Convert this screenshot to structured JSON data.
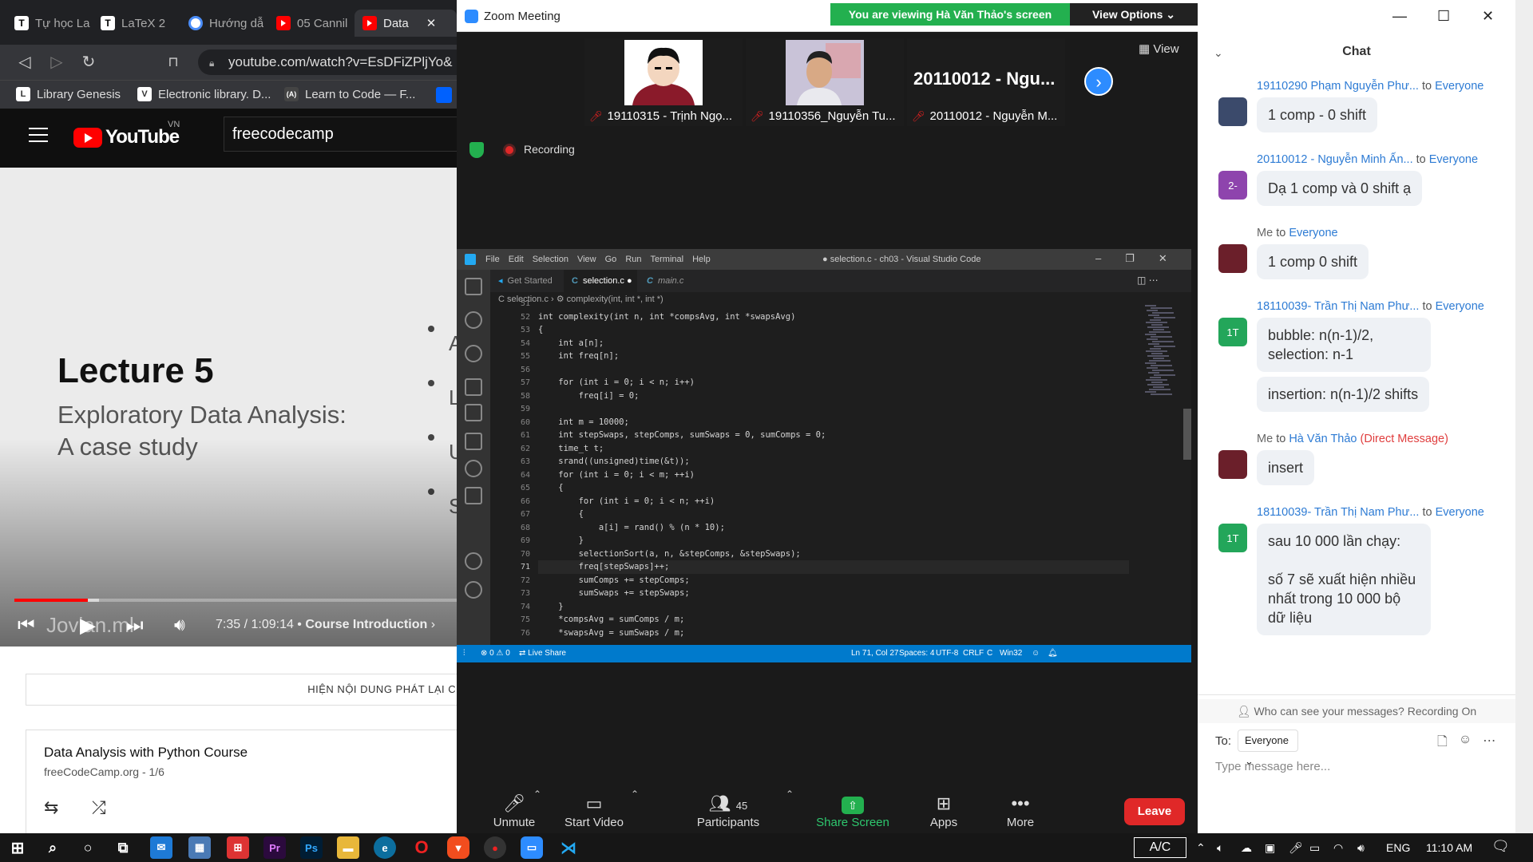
{
  "browser": {
    "tabs": [
      {
        "title": "Tự học La",
        "icon": "T"
      },
      {
        "title": "LaTeX 2",
        "icon": "T"
      },
      {
        "title": "Hướng dẫ",
        "icon": "circle"
      },
      {
        "title": "05 Cannil",
        "icon": "youtube"
      },
      {
        "title": "Data",
        "icon": "youtube",
        "active": true
      }
    ],
    "tab_close": "✕",
    "url": "youtube.com/watch?v=EsDFiZPljYo&",
    "bookmarks": [
      {
        "label": "Library Genesis",
        "icon": "L"
      },
      {
        "label": "Electronic library. D...",
        "icon": "V"
      },
      {
        "label": "Learn to Code — F...",
        "icon": "(A)"
      }
    ]
  },
  "youtube": {
    "logo_text": "YouTube",
    "country": "VN",
    "search_value": "freecodecamp",
    "slide": {
      "title": "Lecture 5",
      "subtitle_line1": "Exploratory Data Analysis:",
      "subtitle_line2": "A case study",
      "bullet_letters": [
        "A",
        "L",
        "U",
        "S"
      ]
    },
    "watermark": "Jovian.ml",
    "time": "7:35 / 1:09:14",
    "chapter": "Course Introduction",
    "chapter_arrow": "›",
    "progress_played": 0.165,
    "progress_buffered": 0.19,
    "replay_banner": "HIỆN NỘI DUNG PHÁT LẠI CU",
    "playlist_title": "Data Analysis with Python Course",
    "playlist_sub": "freeCodeCamp.org - 1/6"
  },
  "zoom": {
    "window_title": "Zoom Meeting",
    "banner": "You are viewing Hà Văn Thảo's screen",
    "view_options": "View Options ⌄",
    "view_label": "View",
    "recording": "Recording",
    "participants": [
      {
        "name": "19110315 - Trịnh Ngọ..."
      },
      {
        "name": "19110356_Nguyễn Tu..."
      },
      {
        "name": "20110012 - Nguyễn M...",
        "big_label": "20110012 - Ngu..."
      }
    ],
    "toolbar": {
      "unmute": "Unmute",
      "start_video": "Start Video",
      "participants": "Participants",
      "participants_count": "45",
      "share_screen": "Share Screen",
      "apps": "Apps",
      "more": "More",
      "leave": "Leave"
    }
  },
  "vscode": {
    "menu": [
      "File",
      "Edit",
      "Selection",
      "View",
      "Go",
      "Run",
      "Terminal",
      "Help"
    ],
    "window_title": "● selection.c - ch03 - Visual Studio Code",
    "tabs": [
      {
        "label": "Get Started",
        "prefix": ""
      },
      {
        "label": "selection.c",
        "prefix": "C",
        "modified": "●"
      },
      {
        "label": "main.c",
        "prefix": "C"
      }
    ],
    "breadcrumb": "C  selection.c  ›  ⚙ complexity(int, int *, int *)",
    "current_line": 71,
    "lines": [
      {
        "n": "51",
        "t": ""
      },
      {
        "n": "52",
        "t": "int complexity(int n, int *compsAvg, int *swapsAvg)"
      },
      {
        "n": "53",
        "t": "{"
      },
      {
        "n": "54",
        "t": "    int a[n];"
      },
      {
        "n": "55",
        "t": "    int freq[n];"
      },
      {
        "n": "56",
        "t": ""
      },
      {
        "n": "57",
        "t": "    for (int i = 0; i < n; i++)"
      },
      {
        "n": "58",
        "t": "        freq[i] = 0;"
      },
      {
        "n": "59",
        "t": ""
      },
      {
        "n": "60",
        "t": "    int m = 10000;"
      },
      {
        "n": "61",
        "t": "    int stepSwaps, stepComps, sumSwaps = 0, sumComps = 0;"
      },
      {
        "n": "62",
        "t": "    time_t t;"
      },
      {
        "n": "63",
        "t": "    srand((unsigned)time(&t));"
      },
      {
        "n": "64",
        "t": "    for (int i = 0; i < m; ++i)"
      },
      {
        "n": "65",
        "t": "    {"
      },
      {
        "n": "66",
        "t": "        for (int i = 0; i < n; ++i)"
      },
      {
        "n": "67",
        "t": "        {"
      },
      {
        "n": "68",
        "t": "            a[i] = rand() % (n * 10);"
      },
      {
        "n": "69",
        "t": "        }"
      },
      {
        "n": "70",
        "t": "        selectionSort(a, n, &stepComps, &stepSwaps);"
      },
      {
        "n": "71",
        "t": "        freq[stepSwaps]++;"
      },
      {
        "n": "72",
        "t": "        sumComps += stepComps;"
      },
      {
        "n": "73",
        "t": "        sumSwaps += stepSwaps;"
      },
      {
        "n": "74",
        "t": "    }"
      },
      {
        "n": "75",
        "t": "    *compsAvg = sumComps / m;"
      },
      {
        "n": "76",
        "t": "    *swapsAvg = sumSwaps / m;"
      }
    ],
    "status": {
      "problems": "⊗ 0 ⚠ 0",
      "liveshare": "Live Share",
      "position": "Ln 71, Col 27",
      "spaces": "Spaces: 4",
      "encoding": "UTF-8",
      "eol": "CRLF",
      "lang": "C",
      "platform": "Win32"
    }
  },
  "chat": {
    "header": "Chat",
    "messages": [
      {
        "sender": "19110290 Phạm Nguyễn Phư...",
        "to": "to",
        "target": "Everyone",
        "avatar": "",
        "avatar_color": "#3b4a6b",
        "bubbles": [
          "1 comp - 0 shift"
        ]
      },
      {
        "sender": "20110012 - Nguyễn Minh Ấn...",
        "to": "to",
        "target": "Everyone",
        "avatar": "2-",
        "avatar_color": "#8e44ad",
        "bubbles": [
          "Dạ 1 comp và 0 shift ạ"
        ]
      },
      {
        "sender": "Me",
        "to": "to",
        "target": "Everyone",
        "avatar": "",
        "avatar_color": "#6b1f2a",
        "bubbles": [
          "1 comp 0 shift"
        ]
      },
      {
        "sender": "18110039- Trần Thị Nam Phư...",
        "to": "to",
        "target": "Everyone",
        "avatar": "1T",
        "avatar_color": "#23a65a",
        "bubbles": [
          "bubble: n(n-1)/2, selection: n-1",
          "insertion: n(n-1)/2 shifts"
        ]
      },
      {
        "sender": "Me",
        "to": "to",
        "target": "Hà Văn Thảo",
        "dm": "(Direct Message)",
        "avatar": "",
        "avatar_color": "#6b1f2a",
        "bubbles": [
          "insert"
        ]
      },
      {
        "sender": "18110039- Trần Thị Nam Phư...",
        "to": "to",
        "target": "Everyone",
        "avatar": "1T",
        "avatar_color": "#23a65a",
        "bubbles": [
          "sau 10 000 lần chạy:\n\nsố 7 sẽ xuất hiện nhiều nhất trong 10 000 bộ dữ liệu"
        ]
      }
    ],
    "who_can_see": "Who can see your messages? Recording On",
    "to_label": "To:",
    "to_value": "Everyone",
    "placeholder": "Type message here..."
  },
  "taskbar": {
    "ac": "A/C",
    "lang": "ENG",
    "time": "11:10 AM"
  }
}
